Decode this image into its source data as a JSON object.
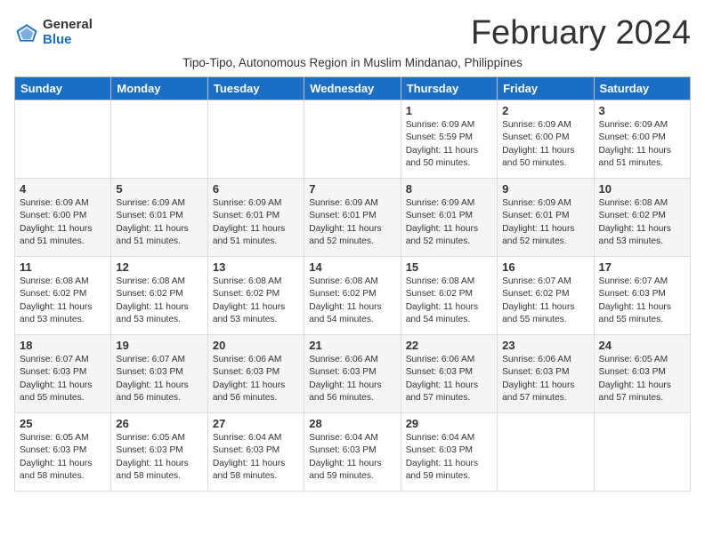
{
  "logo": {
    "general": "General",
    "blue": "Blue"
  },
  "title": {
    "month_year": "February 2024",
    "subtitle": "Tipo-Tipo, Autonomous Region in Muslim Mindanao, Philippines"
  },
  "days_of_week": [
    "Sunday",
    "Monday",
    "Tuesday",
    "Wednesday",
    "Thursday",
    "Friday",
    "Saturday"
  ],
  "weeks": [
    [
      {
        "day": "",
        "info": ""
      },
      {
        "day": "",
        "info": ""
      },
      {
        "day": "",
        "info": ""
      },
      {
        "day": "",
        "info": ""
      },
      {
        "day": "1",
        "info": "Sunrise: 6:09 AM\nSunset: 5:59 PM\nDaylight: 11 hours\nand 50 minutes."
      },
      {
        "day": "2",
        "info": "Sunrise: 6:09 AM\nSunset: 6:00 PM\nDaylight: 11 hours\nand 50 minutes."
      },
      {
        "day": "3",
        "info": "Sunrise: 6:09 AM\nSunset: 6:00 PM\nDaylight: 11 hours\nand 51 minutes."
      }
    ],
    [
      {
        "day": "4",
        "info": "Sunrise: 6:09 AM\nSunset: 6:00 PM\nDaylight: 11 hours\nand 51 minutes."
      },
      {
        "day": "5",
        "info": "Sunrise: 6:09 AM\nSunset: 6:01 PM\nDaylight: 11 hours\nand 51 minutes."
      },
      {
        "day": "6",
        "info": "Sunrise: 6:09 AM\nSunset: 6:01 PM\nDaylight: 11 hours\nand 51 minutes."
      },
      {
        "day": "7",
        "info": "Sunrise: 6:09 AM\nSunset: 6:01 PM\nDaylight: 11 hours\nand 52 minutes."
      },
      {
        "day": "8",
        "info": "Sunrise: 6:09 AM\nSunset: 6:01 PM\nDaylight: 11 hours\nand 52 minutes."
      },
      {
        "day": "9",
        "info": "Sunrise: 6:09 AM\nSunset: 6:01 PM\nDaylight: 11 hours\nand 52 minutes."
      },
      {
        "day": "10",
        "info": "Sunrise: 6:08 AM\nSunset: 6:02 PM\nDaylight: 11 hours\nand 53 minutes."
      }
    ],
    [
      {
        "day": "11",
        "info": "Sunrise: 6:08 AM\nSunset: 6:02 PM\nDaylight: 11 hours\nand 53 minutes."
      },
      {
        "day": "12",
        "info": "Sunrise: 6:08 AM\nSunset: 6:02 PM\nDaylight: 11 hours\nand 53 minutes."
      },
      {
        "day": "13",
        "info": "Sunrise: 6:08 AM\nSunset: 6:02 PM\nDaylight: 11 hours\nand 53 minutes."
      },
      {
        "day": "14",
        "info": "Sunrise: 6:08 AM\nSunset: 6:02 PM\nDaylight: 11 hours\nand 54 minutes."
      },
      {
        "day": "15",
        "info": "Sunrise: 6:08 AM\nSunset: 6:02 PM\nDaylight: 11 hours\nand 54 minutes."
      },
      {
        "day": "16",
        "info": "Sunrise: 6:07 AM\nSunset: 6:02 PM\nDaylight: 11 hours\nand 55 minutes."
      },
      {
        "day": "17",
        "info": "Sunrise: 6:07 AM\nSunset: 6:03 PM\nDaylight: 11 hours\nand 55 minutes."
      }
    ],
    [
      {
        "day": "18",
        "info": "Sunrise: 6:07 AM\nSunset: 6:03 PM\nDaylight: 11 hours\nand 55 minutes."
      },
      {
        "day": "19",
        "info": "Sunrise: 6:07 AM\nSunset: 6:03 PM\nDaylight: 11 hours\nand 56 minutes."
      },
      {
        "day": "20",
        "info": "Sunrise: 6:06 AM\nSunset: 6:03 PM\nDaylight: 11 hours\nand 56 minutes."
      },
      {
        "day": "21",
        "info": "Sunrise: 6:06 AM\nSunset: 6:03 PM\nDaylight: 11 hours\nand 56 minutes."
      },
      {
        "day": "22",
        "info": "Sunrise: 6:06 AM\nSunset: 6:03 PM\nDaylight: 11 hours\nand 57 minutes."
      },
      {
        "day": "23",
        "info": "Sunrise: 6:06 AM\nSunset: 6:03 PM\nDaylight: 11 hours\nand 57 minutes."
      },
      {
        "day": "24",
        "info": "Sunrise: 6:05 AM\nSunset: 6:03 PM\nDaylight: 11 hours\nand 57 minutes."
      }
    ],
    [
      {
        "day": "25",
        "info": "Sunrise: 6:05 AM\nSunset: 6:03 PM\nDaylight: 11 hours\nand 58 minutes."
      },
      {
        "day": "26",
        "info": "Sunrise: 6:05 AM\nSunset: 6:03 PM\nDaylight: 11 hours\nand 58 minutes."
      },
      {
        "day": "27",
        "info": "Sunrise: 6:04 AM\nSunset: 6:03 PM\nDaylight: 11 hours\nand 58 minutes."
      },
      {
        "day": "28",
        "info": "Sunrise: 6:04 AM\nSunset: 6:03 PM\nDaylight: 11 hours\nand 59 minutes."
      },
      {
        "day": "29",
        "info": "Sunrise: 6:04 AM\nSunset: 6:03 PM\nDaylight: 11 hours\nand 59 minutes."
      },
      {
        "day": "",
        "info": ""
      },
      {
        "day": "",
        "info": ""
      }
    ]
  ]
}
